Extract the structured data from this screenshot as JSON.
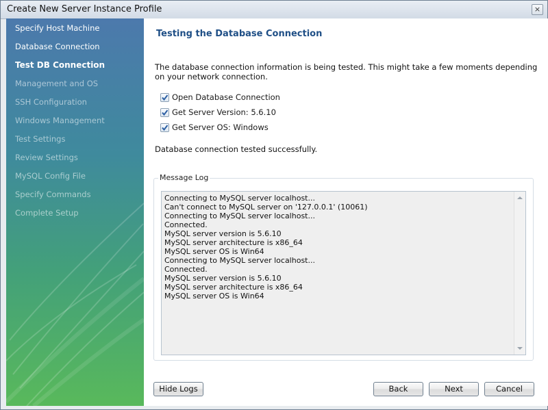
{
  "window": {
    "title": "Create New Server Instance Profile",
    "close_icon": "×"
  },
  "sidebar": {
    "steps": [
      {
        "label": "Specify Host Machine",
        "state": "done"
      },
      {
        "label": "Database Connection",
        "state": "done"
      },
      {
        "label": "Test DB Connection",
        "state": "current"
      },
      {
        "label": "Management and OS",
        "state": "pending"
      },
      {
        "label": "SSH Configuration",
        "state": "pending"
      },
      {
        "label": "Windows Management",
        "state": "pending"
      },
      {
        "label": "Test Settings",
        "state": "pending"
      },
      {
        "label": "Review Settings",
        "state": "pending"
      },
      {
        "label": "MySQL Config File",
        "state": "pending"
      },
      {
        "label": "Specify Commands",
        "state": "pending"
      },
      {
        "label": "Complete Setup",
        "state": "pending"
      }
    ]
  },
  "main": {
    "heading": "Testing the Database Connection",
    "description": "The database connection information is being tested. This might take a few moments depending on your network connection.",
    "checks": [
      {
        "label": "Open Database Connection",
        "checked": true
      },
      {
        "label": "Get Server Version: 5.6.10",
        "checked": true
      },
      {
        "label": "Get Server OS: Windows",
        "checked": true
      }
    ],
    "status": "Database connection tested successfully.",
    "log": {
      "legend": "Message Log",
      "lines": [
        "Connecting to MySQL server localhost...",
        "Can't connect to MySQL server on '127.0.0.1' (10061)",
        "Connecting to MySQL server localhost...",
        "Connected.",
        "MySQL server version is 5.6.10",
        "MySQL server architecture is x86_64",
        "MySQL server OS is Win64",
        "Connecting to MySQL server localhost...",
        "Connected.",
        "MySQL server version is 5.6.10",
        "MySQL server architecture is x86_64",
        "MySQL server OS is Win64"
      ]
    }
  },
  "buttons": {
    "hide_logs": "Hide Logs",
    "back": "Back",
    "next": "Next",
    "cancel": "Cancel"
  },
  "colors": {
    "heading": "#1f4f86",
    "sidebar_top": "#4c79ac",
    "sidebar_bottom": "#59b95b",
    "check": "#2c5fa3"
  }
}
